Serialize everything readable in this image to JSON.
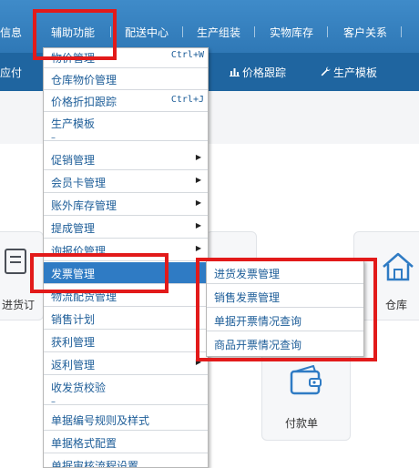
{
  "topnav": {
    "items": [
      "信息",
      "辅助功能",
      "配送中心",
      "生产组装",
      "实物库存",
      "客户关系"
    ]
  },
  "toolbar": {
    "left_fragment": "应付",
    "price_tracking": "价格跟踪",
    "production_template": "生产模板"
  },
  "cards": {
    "purchase_order_fragment": "进货订",
    "warehouse": "仓库",
    "payment": "付款单"
  },
  "menu": {
    "items": [
      {
        "label": "物价管理",
        "shortcut": "Ctrl+W"
      },
      {
        "label": "仓库物价管理"
      },
      {
        "label": "价格折扣跟踪",
        "shortcut": "Ctrl+J"
      },
      {
        "label": "生产模板"
      },
      {
        "label": "促销管理",
        "has_submenu": true
      },
      {
        "label": "会员卡管理",
        "has_submenu": true
      },
      {
        "label": "账外库存管理",
        "has_submenu": true
      },
      {
        "label": "提成管理",
        "has_submenu": true
      },
      {
        "label": "询报价管理",
        "has_submenu": true
      },
      {
        "label": "发票管理",
        "has_submenu": true,
        "selected": true
      },
      {
        "label": "物流配货管理"
      },
      {
        "label": "销售计划"
      },
      {
        "label": "获利管理"
      },
      {
        "label": "返利管理",
        "has_submenu": true
      },
      {
        "label": "收发货校验"
      },
      {
        "label": "单据编号规则及样式"
      },
      {
        "label": "单据格式配置"
      },
      {
        "label": "单据审核流程设置"
      }
    ],
    "separator": "–"
  },
  "submenu": {
    "items": [
      "进货发票管理",
      "销售发票管理",
      "单据开票情况查询",
      "商品开票情况查询"
    ]
  },
  "colors": {
    "accent": "#2f7bc4",
    "highlight": "#e21a1a",
    "nav_bg": "#3f8bc9",
    "toolbar_bg": "#1f65a0"
  }
}
